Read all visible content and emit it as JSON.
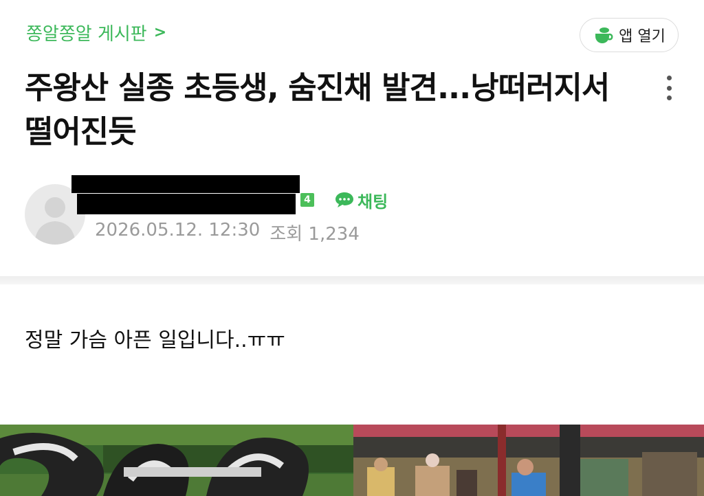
{
  "header": {
    "board_name": "쫑알쫑알 게시판",
    "board_chevron": ">",
    "app_open_label": "앱 열기"
  },
  "post": {
    "title": "주왕산 실종 초등생, 숨진채 발견...낭떠러지서 떨어진듯",
    "author_level": "4",
    "chat_label": "채팅",
    "date": "2026.05.12. 12:30",
    "views": "조회 1,234",
    "body": "정말 가슴 아픈 일입니다..ㅠㅠ"
  },
  "icons": {
    "app": "cup-icon",
    "more": "more-vertical-icon",
    "chat": "chat-bubble-icon",
    "avatar": "default-avatar-icon"
  },
  "colors": {
    "accent": "#3cb85a",
    "meta_text": "#9a9a9a"
  }
}
